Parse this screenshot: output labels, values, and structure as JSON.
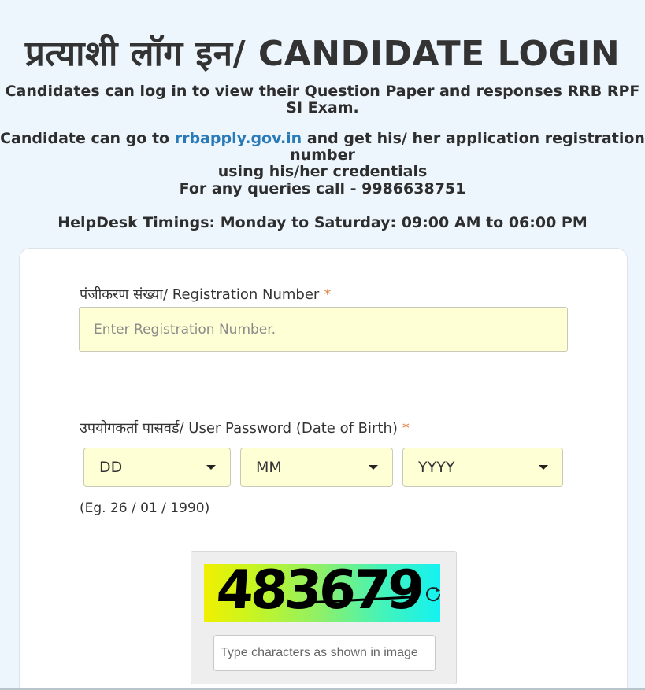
{
  "header": {
    "title": "प्रत्याशी लॉग इन/ CANDIDATE LOGIN"
  },
  "info": {
    "line1": "Candidates can log in to view their Question Paper and responses RRB RPF SI Exam.",
    "line2_prefix": "Candidate can go to ",
    "line2_link": "rrbapply.gov.in",
    "line2_suffix": " and get his/ her application registration number",
    "line2_cont": "using his/her credentials",
    "line3": "For any queries call - 9986638751",
    "line4": "HelpDesk Timings: Monday to Saturday: 09:00 AM to 06:00 PM"
  },
  "form": {
    "registration_label": "पंजीकरण संख्या/ Registration Number",
    "required_mark": "*",
    "registration_placeholder": "Enter Registration Number.",
    "password_label": "उपयोगकर्ता पासवर्ड/ User Password (Date of Birth)",
    "day_select": "DD",
    "month_select": "MM",
    "year_select": "YYYY",
    "example": "(Eg. 26 / 01 / 1990)",
    "captcha_text": "483679",
    "captcha_placeholder": "Type characters as shown in image"
  },
  "colors": {
    "background": "#eef6fd",
    "link": "#2a7ab8",
    "required": "#e27d3c",
    "input_bg": "#ffffd5"
  }
}
